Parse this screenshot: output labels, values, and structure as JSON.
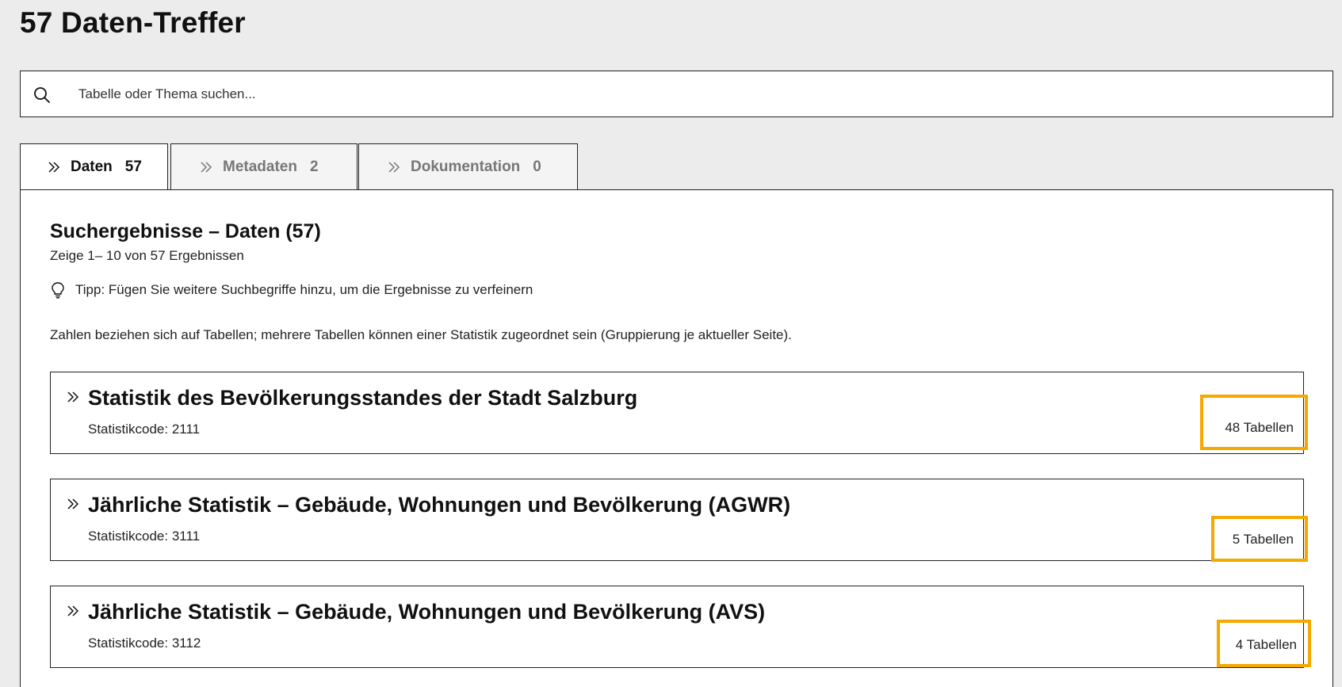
{
  "page": {
    "title": "57 Daten-Treffer"
  },
  "search": {
    "placeholder": "Tabelle oder Thema suchen..."
  },
  "tabs": [
    {
      "label": "Daten",
      "count": "57",
      "active": true
    },
    {
      "label": "Metadaten",
      "count": "2",
      "active": false
    },
    {
      "label": "Dokumentation",
      "count": "0",
      "active": false
    }
  ],
  "results_panel": {
    "heading": "Suchergebnisse – Daten (57)",
    "range": "Zeige 1– 10 von 57 Ergebnissen",
    "tip": "Tipp: Fügen Sie weitere Suchbegriffe hinzu, um die Ergebnisse zu verfeinern",
    "note": "Zahlen beziehen sich auf Tabellen; mehrere Tabellen können einer Statistik zugeordnet sein (Gruppierung je aktueller Seite)."
  },
  "results": [
    {
      "title": "Statistik des Bevölkerungsstandes der Stadt Salzburg",
      "code": "Statistikcode: 2111",
      "tables": "48 Tabellen"
    },
    {
      "title": "Jährliche Statistik – Gebäude, Wohnungen und Bevölkerung (AGWR)",
      "code": "Statistikcode: 3111",
      "tables": "5 Tabellen"
    },
    {
      "title": "Jährliche Statistik – Gebäude, Wohnungen und Bevölkerung (AVS)",
      "code": "Statistikcode: 3112",
      "tables": "4 Tabellen"
    }
  ],
  "colors": {
    "highlight": "#f5a800",
    "background": "#ececec",
    "border": "#222222"
  },
  "icons": {
    "search": "search-icon",
    "tab": "chevron-double-right-icon",
    "tip": "lightbulb-icon"
  }
}
